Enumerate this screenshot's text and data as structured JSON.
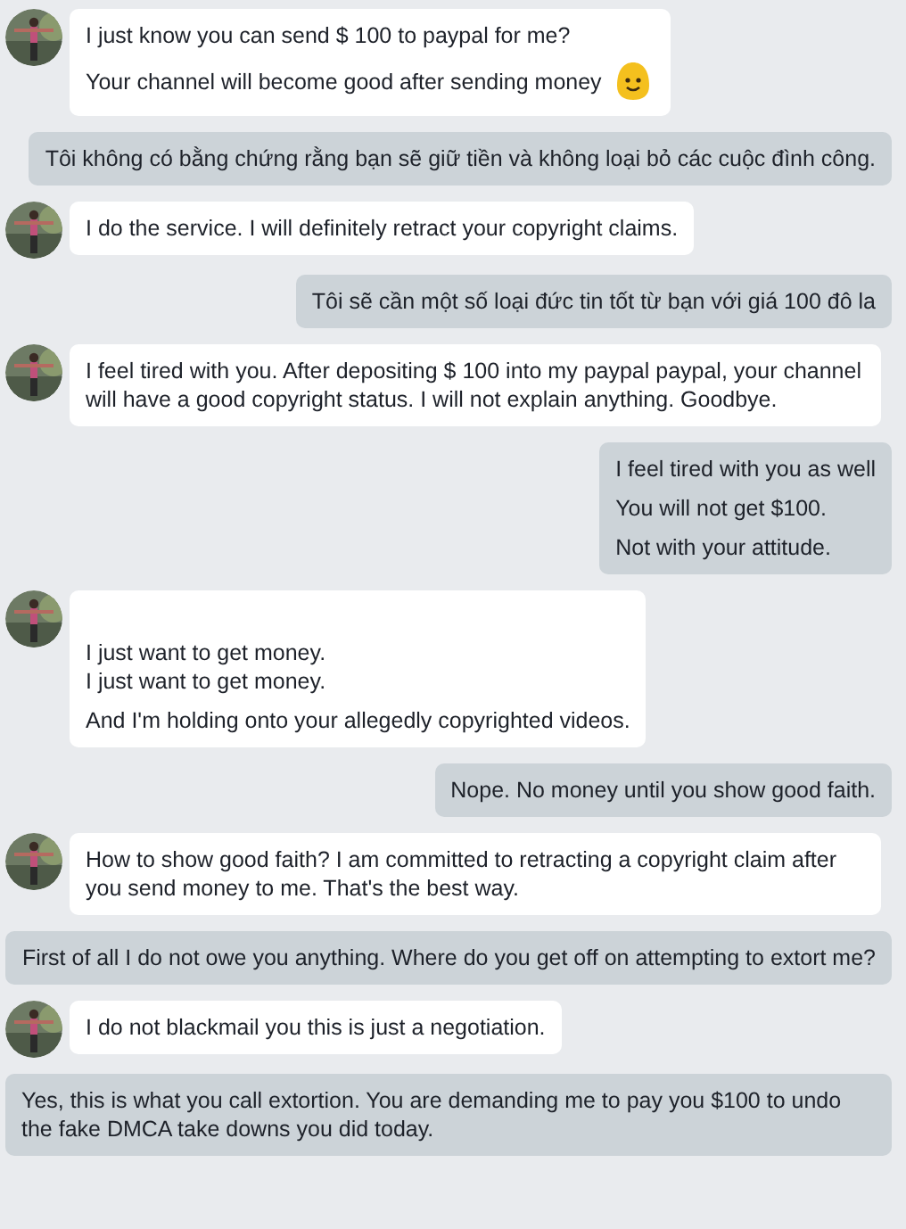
{
  "messages": [
    {
      "outgoing": false,
      "paragraphs": [
        [
          "I just know you can send $ 100 to paypal for me?"
        ],
        [
          "Your channel will become good after sending money"
        ]
      ],
      "smiley": true
    },
    {
      "outgoing": true,
      "paragraphs": [
        [
          "Tôi không có bằng chứng rằng bạn sẽ giữ tiền và không loại bỏ các cuộc đình công."
        ]
      ]
    },
    {
      "outgoing": false,
      "paragraphs": [
        [
          "I do the service. I will definitely retract your copyright claims."
        ]
      ]
    },
    {
      "outgoing": true,
      "paragraphs": [
        [
          "Tôi sẽ cần một số loại đức tin tốt từ bạn với giá 100 đô la"
        ]
      ]
    },
    {
      "outgoing": false,
      "paragraphs": [
        [
          "I feel tired with you. After depositing $ 100 into my paypal paypal, your channel will have a good copyright status. I will not explain anything. Goodbye."
        ]
      ]
    },
    {
      "outgoing": true,
      "paragraphs": [
        [
          "I feel tired with you as well"
        ],
        [
          "You will not get $100."
        ],
        [
          "Not with your attitude."
        ]
      ]
    },
    {
      "outgoing": false,
      "paragraphs": [
        [
          "I just want to get money.",
          "I just want to get money."
        ],
        [
          "And I'm holding onto your allegedly copyrighted videos."
        ]
      ],
      "leading_blank": true
    },
    {
      "outgoing": true,
      "paragraphs": [
        [
          "Nope. No money until you show good faith."
        ]
      ]
    },
    {
      "outgoing": false,
      "paragraphs": [
        [
          "How to show good faith? I am committed to retracting a copyright claim after you send money to me. That's the best way."
        ]
      ]
    },
    {
      "outgoing": true,
      "paragraphs": [
        [
          "First of all I do not owe you anything. Where do you get off on attempting to extort me?"
        ]
      ]
    },
    {
      "outgoing": false,
      "paragraphs": [
        [
          "I do not blackmail you this is just a negotiation."
        ]
      ]
    },
    {
      "outgoing": true,
      "paragraphs": [
        [
          "Yes, this is what you call extortion. You are demanding me to pay you $100 to undo the fake DMCA take downs you did today."
        ]
      ]
    }
  ]
}
